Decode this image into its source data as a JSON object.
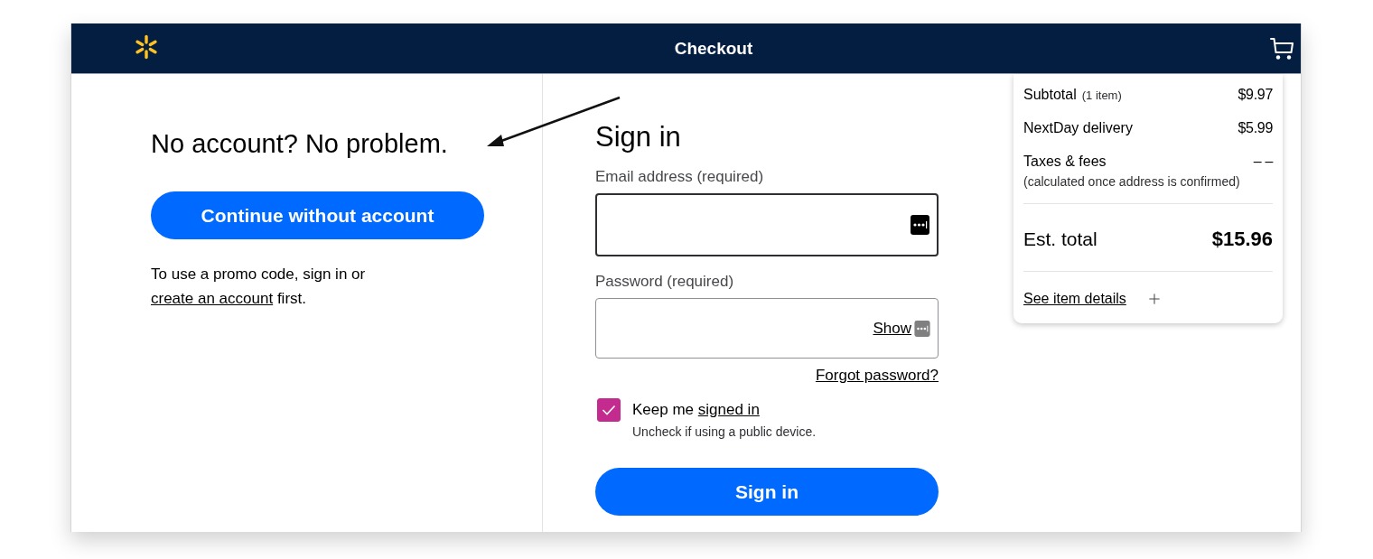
{
  "header": {
    "title": "Checkout"
  },
  "guest": {
    "heading": "No account? No problem.",
    "button": "Continue without account",
    "promo": {
      "text": "To use a promo code, sign in or",
      "link": "create an account",
      "after": "first."
    }
  },
  "sign_in": {
    "heading": "Sign in",
    "email": {
      "label": "Email address (required)",
      "focused": true
    },
    "password": {
      "label": "Password (required)",
      "focused": false,
      "show_link": "Show"
    },
    "forgot_link": "Forgot password?",
    "keep_signed_in": {
      "checked": true,
      "text": "Keep me",
      "link": "signed in",
      "hint": "Uncheck if using a public device."
    },
    "button": "Sign in"
  },
  "summary": {
    "lines": [
      {
        "label": "Subtotal",
        "note": "(1 item)",
        "value": "$9.97"
      },
      {
        "label": "NextDay delivery",
        "value": "$5.99"
      },
      {
        "label": "Taxes & fees",
        "value": "– –",
        "hint": "(calculated once address is confirmed)"
      }
    ],
    "total": {
      "label": "Est. total",
      "value": "$15.96"
    },
    "details_link": "See item details"
  }
}
